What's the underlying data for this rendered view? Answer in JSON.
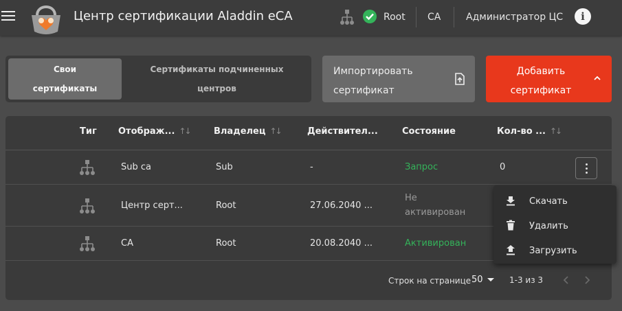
{
  "header": {
    "title": "Центр сертификации Aladdin eCA",
    "role_root": "Root",
    "role_ca": "CA",
    "user": "Администратор ЦС",
    "info_glyph": "i",
    "icons": [
      "menu-icon",
      "app-logo",
      "hierarchy-icon",
      "check-circle-icon",
      "info-icon"
    ],
    "status_color": "#34b35a"
  },
  "tabs": [
    {
      "line1": "Свои",
      "line2": "сертификаты",
      "active": true
    },
    {
      "line1": "Сертификаты подчиненных",
      "line2": "центров",
      "active": false
    }
  ],
  "actions": {
    "import": {
      "line1": "Импортировать",
      "line2": "сертификат",
      "icon": "file-upload-icon"
    },
    "add": {
      "line1": "Добавить",
      "line2": "сертификат",
      "icon": "chevron-up-icon",
      "color": "#e8381c"
    }
  },
  "table": {
    "columns": [
      {
        "label": "Тиг",
        "sortable": false
      },
      {
        "label": "Отображ...",
        "sortable": true
      },
      {
        "label": "Владелец",
        "sortable": true
      },
      {
        "label": "Действител...",
        "sortable": false
      },
      {
        "label": "Состояние",
        "sortable": false
      },
      {
        "label": "Кол-во ...",
        "sortable": true
      }
    ],
    "rows": [
      {
        "name": "Sub ca",
        "owner": "Sub",
        "valid": "-",
        "status": "Запрос",
        "status_type": "green",
        "count": "0"
      },
      {
        "name": "Центр серт...",
        "owner": "Root",
        "valid": "27.06.2040 ...",
        "status_l1": "Не",
        "status_l2": "активирован",
        "status_type": "grey"
      },
      {
        "name": "CA",
        "owner": "Root",
        "valid": "20.08.2040 ...",
        "status": "Активирован",
        "status_type": "green"
      }
    ]
  },
  "pagination": {
    "rows_per_page_label": "Строк на странице",
    "rows_per_page": "50",
    "range": "1-3 из 3"
  },
  "row_menu": {
    "items": [
      {
        "label": "Скачать",
        "icon": "download-icon"
      },
      {
        "label": "Удалить",
        "icon": "trash-icon"
      },
      {
        "label": "Загрузить",
        "icon": "upload-icon"
      }
    ]
  }
}
